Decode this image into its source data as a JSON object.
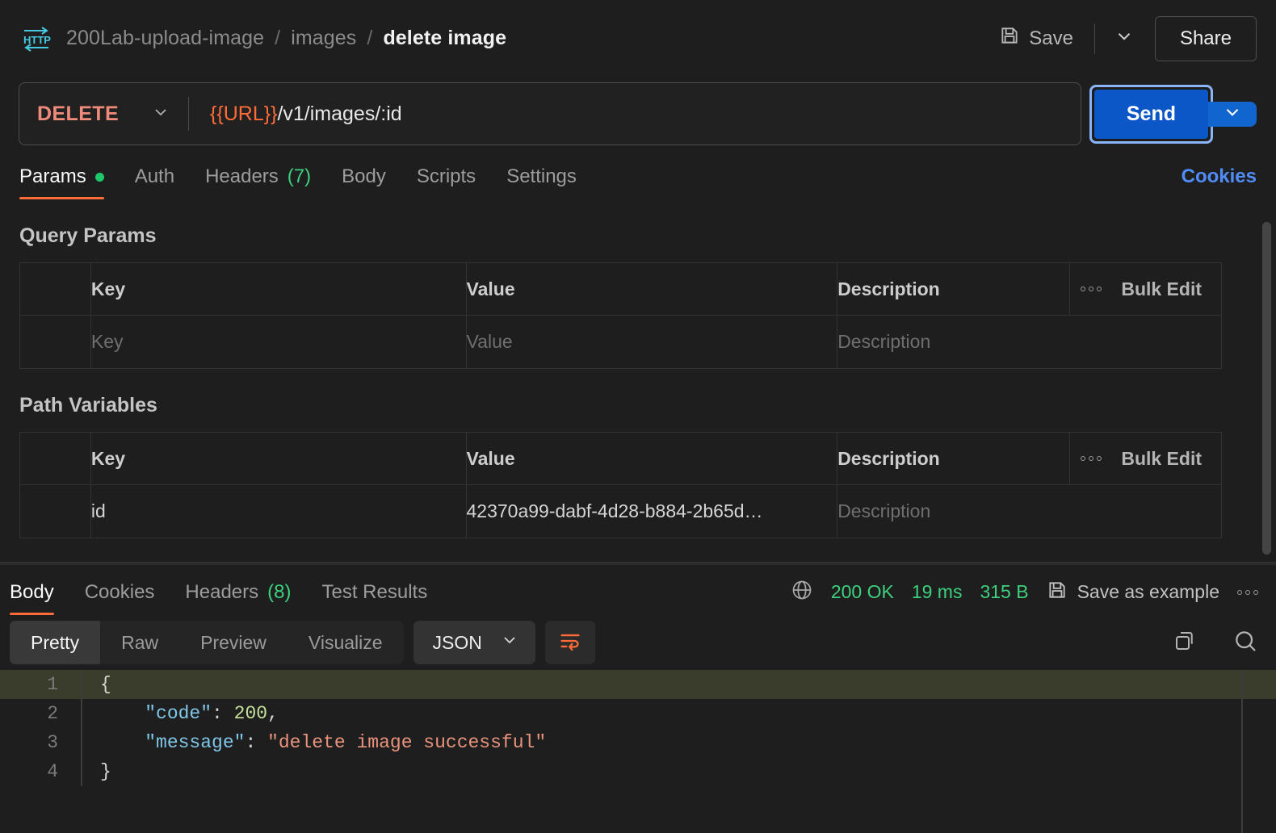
{
  "header": {
    "icon": "http-protocol-icon",
    "breadcrumb": [
      "200Lab-upload-image",
      "images",
      "delete image"
    ],
    "separator": "/",
    "save_label": "Save",
    "save_icon": "floppy-disk-icon",
    "save_caret_icon": "chevron-down-icon",
    "share_label": "Share"
  },
  "url_bar": {
    "method": "DELETE",
    "method_caret_icon": "chevron-down-icon",
    "url_variable": "{{URL}}",
    "url_path": "/v1/images/:id",
    "send_label": "Send",
    "send_caret_icon": "chevron-down-icon"
  },
  "request_tabs": {
    "items": [
      {
        "label": "Params",
        "badge": "",
        "dot": true,
        "active": true
      },
      {
        "label": "Auth",
        "badge": "",
        "dot": false,
        "active": false
      },
      {
        "label": "Headers",
        "badge": "(7)",
        "dot": false,
        "active": false
      },
      {
        "label": "Body",
        "badge": "",
        "dot": false,
        "active": false
      },
      {
        "label": "Scripts",
        "badge": "",
        "dot": false,
        "active": false
      },
      {
        "label": "Settings",
        "badge": "",
        "dot": false,
        "active": false
      }
    ],
    "cookies_label": "Cookies"
  },
  "query_params": {
    "title": "Query Params",
    "columns": [
      "Key",
      "Value",
      "Description"
    ],
    "bulk_edit_label": "Bulk Edit",
    "more_icon": "three-dots-icon",
    "rows": [
      {
        "key": "Key",
        "value": "Value",
        "description": "Description",
        "placeholder": true
      }
    ]
  },
  "path_variables": {
    "title": "Path Variables",
    "columns": [
      "Key",
      "Value",
      "Description"
    ],
    "bulk_edit_label": "Bulk Edit",
    "more_icon": "three-dots-icon",
    "rows": [
      {
        "key": "id",
        "value": "42370a99-dabf-4d28-b884-2b65d…",
        "description": "Description",
        "placeholder": false
      }
    ]
  },
  "response": {
    "tabs": [
      {
        "label": "Body",
        "badge": "",
        "active": true
      },
      {
        "label": "Cookies",
        "badge": "",
        "active": false
      },
      {
        "label": "Headers",
        "badge": "(8)",
        "active": false
      },
      {
        "label": "Test Results",
        "badge": "",
        "active": false
      }
    ],
    "globe_icon": "globe-icon",
    "status": "200 OK",
    "time": "19 ms",
    "size": "315 B",
    "save_example_label": "Save as example",
    "save_example_icon": "floppy-disk-icon",
    "more_icon": "three-dots-icon",
    "format_tabs": [
      {
        "label": "Pretty",
        "active": true
      },
      {
        "label": "Raw",
        "active": false
      },
      {
        "label": "Preview",
        "active": false
      },
      {
        "label": "Visualize",
        "active": false
      }
    ],
    "language": "JSON",
    "language_caret_icon": "chevron-down-icon",
    "wrap_icon": "word-wrap-icon",
    "copy_icon": "copy-icon",
    "search_icon": "search-icon",
    "body_lines": [
      {
        "num": "1",
        "highlighted": true,
        "segments": [
          {
            "t": "{",
            "c": "punct"
          }
        ]
      },
      {
        "num": "2",
        "highlighted": false,
        "segments": [
          {
            "t": "    ",
            "c": "punct"
          },
          {
            "t": "\"code\"",
            "c": "key"
          },
          {
            "t": ": ",
            "c": "punct"
          },
          {
            "t": "200",
            "c": "num"
          },
          {
            "t": ",",
            "c": "punct"
          }
        ]
      },
      {
        "num": "3",
        "highlighted": false,
        "segments": [
          {
            "t": "    ",
            "c": "punct"
          },
          {
            "t": "\"message\"",
            "c": "key"
          },
          {
            "t": ": ",
            "c": "punct"
          },
          {
            "t": "\"delete image successful\"",
            "c": "str"
          }
        ]
      },
      {
        "num": "4",
        "highlighted": false,
        "segments": [
          {
            "t": "}",
            "c": "punct"
          }
        ]
      }
    ]
  },
  "colors": {
    "accent_orange": "#ff6c37",
    "send_blue": "#0b57c7",
    "focus_blue": "#8ab4f8",
    "link_blue": "#4f8cf7",
    "status_green": "#3dd07d",
    "method_red": "#f08a7a",
    "http_icon_cyan": "#45c8e0",
    "background": "#1e1e1e"
  }
}
